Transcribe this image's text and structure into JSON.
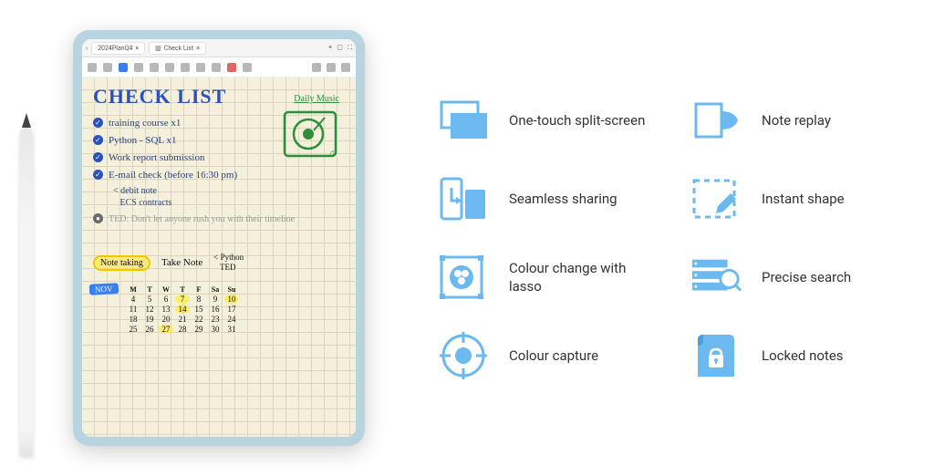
{
  "colors": {
    "accent": "#6CB9F0",
    "ink": "#2a52b8"
  },
  "tablet": {
    "tabs": [
      "2024PlanQ4",
      "Check List"
    ],
    "note": {
      "title": "CHECK LIST",
      "daily_music": "Daily Music",
      "items": [
        "training course x1",
        "Python - SQL x1",
        "Work report submission",
        "E-mail check (before 16:30 pm)"
      ],
      "sub_items": [
        "debit note",
        "ECS contracts"
      ],
      "grey_item": "TED: Don't let anyone rush you with their timeline",
      "note_taking_label": "Note taking",
      "take_note": "Take Note",
      "take_note_sub": [
        "Python",
        "TED"
      ],
      "calendar": {
        "month": "NOV",
        "days_header": [
          "M",
          "T",
          "W",
          "T",
          "F",
          "Sa",
          "Su"
        ],
        "rows": [
          [
            "4",
            "5",
            "6",
            "7",
            "8",
            "9",
            "10"
          ],
          [
            "11",
            "12",
            "13",
            "14",
            "15",
            "16",
            "17"
          ],
          [
            "18",
            "19",
            "20",
            "21",
            "22",
            "23",
            "24"
          ],
          [
            "25",
            "26",
            "27",
            "28",
            "29",
            "30",
            "31"
          ]
        ],
        "highlighted": [
          "7",
          "10",
          "14",
          "27"
        ]
      }
    }
  },
  "features": [
    {
      "icon": "split-screen-icon",
      "label": "One-touch split-screen"
    },
    {
      "icon": "note-replay-icon",
      "label": "Note replay"
    },
    {
      "icon": "seamless-sharing-icon",
      "label": "Seamless sharing"
    },
    {
      "icon": "instant-shape-icon",
      "label": "Instant shape"
    },
    {
      "icon": "colour-lasso-icon",
      "label": "Colour change with lasso"
    },
    {
      "icon": "precise-search-icon",
      "label": "Precise search"
    },
    {
      "icon": "colour-capture-icon",
      "label": "Colour capture"
    },
    {
      "icon": "locked-notes-icon",
      "label": "Locked notes"
    }
  ]
}
